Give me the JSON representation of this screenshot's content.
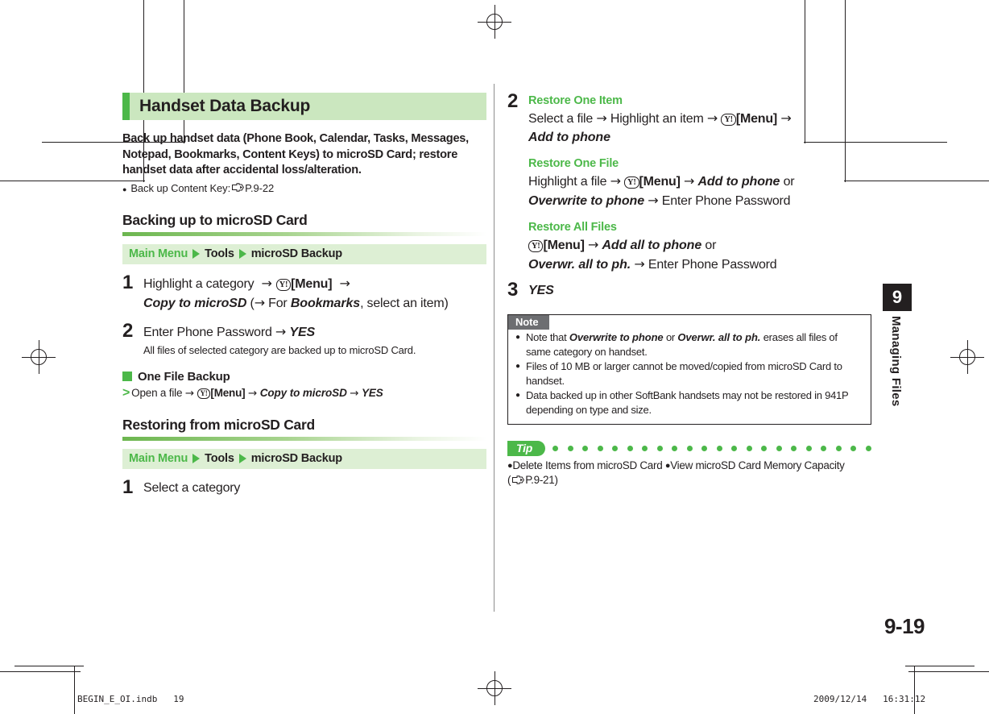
{
  "header": {
    "title": "Handset Data Backup"
  },
  "intro": {
    "paragraph": "Back up handset data (Phone Book, Calendar, Tasks, Messages, Notepad, Bookmarks, Content Keys) to microSD Card; restore handset data after accidental loss/alteration.",
    "bullet_label": "Back up Content Key:",
    "bullet_ref": "P.9-22"
  },
  "sections": {
    "backing_up": {
      "heading": "Backing up to microSD Card",
      "breadcrumb": {
        "root": "Main Menu",
        "level2": "Tools",
        "level3": "microSD Backup"
      },
      "step1": {
        "num": "1",
        "t1": "Highlight a category",
        "key": "Y!",
        "k1": "[Menu]",
        "cmd1": "Copy to microSD",
        "t2": "(",
        "t3": "For",
        "cmd2": "Bookmarks",
        "t4": ", select an item)"
      },
      "step2": {
        "num": "2",
        "t1": "Enter Phone Password",
        "cmd1": "YES",
        "sub": "All files of selected category are backed up to microSD Card."
      },
      "one_file": {
        "heading": "One File Backup",
        "t1": "Open a file",
        "key": "Y!",
        "k1": "[Menu]",
        "cmd1": "Copy to microSD",
        "cmd2": "YES"
      }
    },
    "restoring": {
      "heading": "Restoring from microSD Card",
      "breadcrumb": {
        "root": "Main Menu",
        "level2": "Tools",
        "level3": "microSD Backup"
      },
      "step1": {
        "num": "1",
        "t1": "Select a category"
      },
      "step2": {
        "num": "2",
        "label_one_item": "Restore One Item",
        "oi_t1": "Select a file",
        "oi_t2": "Highlight an item",
        "oi_key": "Y!",
        "oi_k1": "[Menu]",
        "oi_cmd": "Add to phone",
        "label_one_file": "Restore One File",
        "of_t1": "Highlight a file",
        "of_key": "Y!",
        "of_k1": "[Menu]",
        "of_cmd1": "Add to phone",
        "of_or": "or",
        "of_cmd2": "Overwrite to phone",
        "of_t2": "Enter Phone Password",
        "label_all_files": "Restore All Files",
        "af_key": "Y!",
        "af_k1": "[Menu]",
        "af_cmd1": "Add all to phone",
        "af_or": "or",
        "af_cmd2": "Overwr. all to ph.",
        "af_t2": "Enter Phone Password"
      },
      "step3": {
        "num": "3",
        "cmd1": "YES"
      }
    }
  },
  "note": {
    "badge": "Note",
    "items": [
      {
        "p1": "Note that",
        "c1": "Overwrite to phone",
        "p2": "or",
        "c2": "Overwr. all to ph.",
        "p3": "erases all files of same category on handset."
      },
      {
        "p1": "Files of 10 MB or larger cannot be moved/copied from microSD Card to handset.",
        "c1": "",
        "p2": "",
        "c2": "",
        "p3": ""
      },
      {
        "p1": "Data backed up in other SoftBank handsets may not be restored in 941P depending on type and size.",
        "c1": "",
        "p2": "",
        "c2": "",
        "p3": ""
      }
    ]
  },
  "tip": {
    "badge": "Tip",
    "item1": "Delete Items from microSD Card",
    "item2": "View microSD Card Memory Capacity",
    "ref": "P.9-21",
    "dot_count": 22
  },
  "chapter": {
    "number": "9",
    "label": "Managing Files"
  },
  "page_number": "9-19",
  "footer": {
    "file": "BEGIN_E_OI.indb   19",
    "stamp": "2009/12/14   16:31:12"
  },
  "colors": {
    "green": "#4cb849",
    "green_light": "#cbe7bf",
    "green_band": "#ddefd4",
    "gray_badge": "#6d6e71",
    "ink": "#231f20"
  }
}
